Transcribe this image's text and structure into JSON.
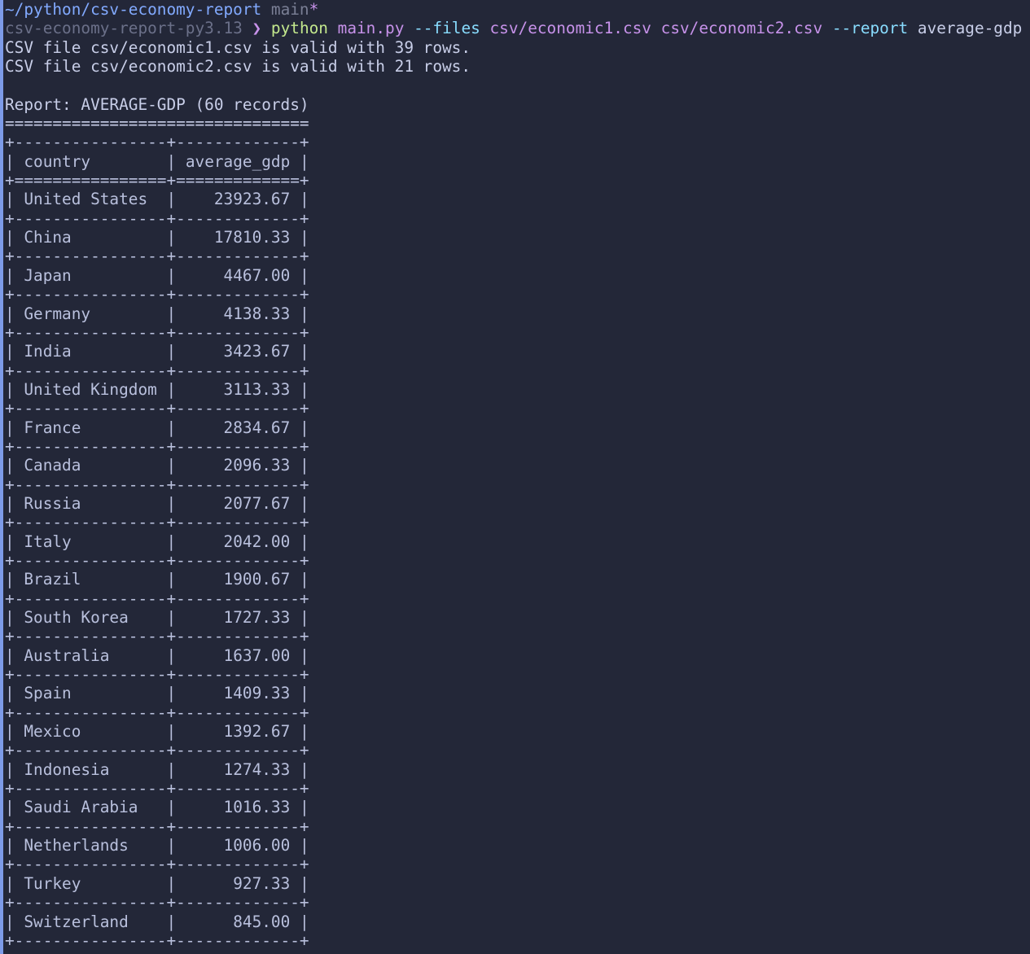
{
  "colors": {
    "background": "#232738",
    "accent_bar": "#7d9be8",
    "text": "#c8cee8",
    "path": "#82aaff",
    "branch": "#7a7f95",
    "command": "#c3e88d",
    "argument": "#c792ea",
    "flag": "#89ddff"
  },
  "prompt": {
    "path": "~/python/csv-economy-report",
    "branch": "main",
    "dirty_marker": "*",
    "env": "csv-economy-report-py3.13",
    "arrow": "❯"
  },
  "command": {
    "program": "python",
    "script": "main.py",
    "files_flag": "--files",
    "file1": "csv/economic1.csv",
    "file2": "csv/economic2.csv",
    "report_flag": "--report",
    "report_value": "average-gdp"
  },
  "output": {
    "validation": [
      "CSV file csv/economic1.csv is valid with 39 rows.",
      "CSV file csv/economic2.csv is valid with 21 rows."
    ],
    "report_title": "Report: AVERAGE-GDP (60 records)",
    "underline": "================================"
  },
  "table": {
    "columns": [
      "country",
      "average_gdp"
    ],
    "rows": [
      {
        "country": "United States",
        "average_gdp": "23923.67"
      },
      {
        "country": "China",
        "average_gdp": "17810.33"
      },
      {
        "country": "Japan",
        "average_gdp": "4467.00"
      },
      {
        "country": "Germany",
        "average_gdp": "4138.33"
      },
      {
        "country": "India",
        "average_gdp": "3423.67"
      },
      {
        "country": "United Kingdom",
        "average_gdp": "3113.33"
      },
      {
        "country": "France",
        "average_gdp": "2834.67"
      },
      {
        "country": "Canada",
        "average_gdp": "2096.33"
      },
      {
        "country": "Russia",
        "average_gdp": "2077.67"
      },
      {
        "country": "Italy",
        "average_gdp": "2042.00"
      },
      {
        "country": "Brazil",
        "average_gdp": "1900.67"
      },
      {
        "country": "South Korea",
        "average_gdp": "1727.33"
      },
      {
        "country": "Australia",
        "average_gdp": "1637.00"
      },
      {
        "country": "Spain",
        "average_gdp": "1409.33"
      },
      {
        "country": "Mexico",
        "average_gdp": "1392.67"
      },
      {
        "country": "Indonesia",
        "average_gdp": "1274.33"
      },
      {
        "country": "Saudi Arabia",
        "average_gdp": "1016.33"
      },
      {
        "country": "Netherlands",
        "average_gdp": "1006.00"
      },
      {
        "country": "Turkey",
        "average_gdp": "927.33"
      },
      {
        "country": "Switzerland",
        "average_gdp": "845.00"
      }
    ]
  }
}
